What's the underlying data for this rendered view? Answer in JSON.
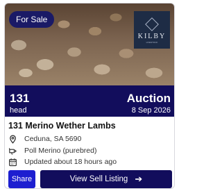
{
  "listing": {
    "badge": "For Sale",
    "agent_logo": {
      "name": "KILBY",
      "sub": "LIVESTOCK"
    },
    "head_count": "131",
    "head_unit": "head",
    "sale_type": "Auction",
    "sale_date": "8 Sep 2026",
    "title": "131 Merino Wether Lambs",
    "location": "Ceduna, SA 5690",
    "breed": "Poll Merino (purebred)",
    "updated": "Updated about 18 hours ago"
  },
  "actions": {
    "share_label": "Share",
    "view_label": "View Sell Listing",
    "view_icon": "arrow-right-icon"
  },
  "icons": [
    "location-pin-icon",
    "breed-tag-icon",
    "calendar-icon"
  ],
  "colors": {
    "navy": "#120d5c",
    "share_blue": "#1d1fd0",
    "badge": "#1a1a66"
  }
}
